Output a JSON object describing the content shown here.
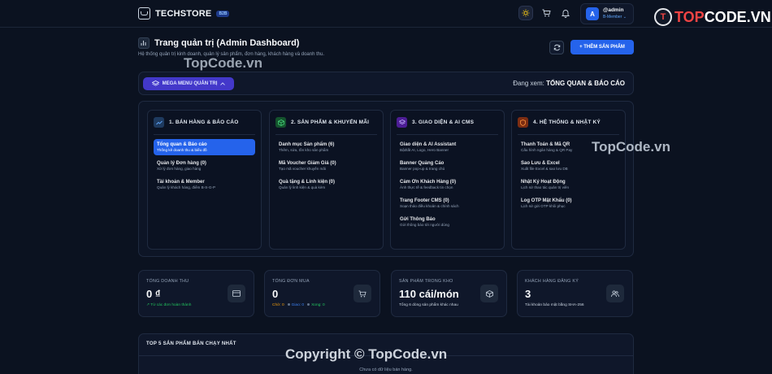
{
  "brand": {
    "name": "TECHSTORE",
    "badge": "B2B"
  },
  "topbar": {
    "icons": [
      "sun-icon",
      "cart-icon",
      "bell-icon"
    ],
    "user": {
      "avatar_letter": "A",
      "name": "@admin",
      "role": "B-Member ⌄"
    }
  },
  "watermark_logo": {
    "prefix": "T",
    "text_a": "TOP",
    "text_b": "CODE.VN"
  },
  "header": {
    "title": "Trang quản trị (Admin Dashboard)",
    "subtitle": "Hệ thống quản trị kinh doanh, quản lý sản phẩm, đơn hàng, khách hàng và doanh thu.",
    "add_button": "+ THÊM SẢN PHẨM"
  },
  "mega_bar": {
    "button": "MEGA MENU QUẢN TRỊ",
    "viewing_label": "Đang xem:",
    "viewing_value": "TỔNG QUAN & BÁO CÁO"
  },
  "mega_columns": [
    {
      "title": "1. BÁN HÀNG & BÁO CÁO",
      "items": [
        {
          "t": "Tổng quan & Báo cáo",
          "d": "Thống kê doanh thu & biểu đồ",
          "active": true
        },
        {
          "t": "Quản lý Đơn hàng (0)",
          "d": "Xử lý đơn hàng, giao hàng"
        },
        {
          "t": "Tài khoản & Member",
          "d": "Quản lý khách hàng, điểm B-S-G-P"
        }
      ]
    },
    {
      "title": "2. SẢN PHẨM & KHUYẾN MÃI",
      "items": [
        {
          "t": "Danh mục Sản phẩm (6)",
          "d": "Thêm, sửa, tồn kho sản phẩm"
        },
        {
          "t": "Mã Voucher Giảm Giá (0)",
          "d": "Tạo mã voucher khuyến mãi"
        },
        {
          "t": "Quà tặng & Linh kiện (0)",
          "d": "Quản lý linh kiện & quà kèm"
        }
      ]
    },
    {
      "title": "3. GIAO DIỆN & AI CMS",
      "items": [
        {
          "t": "Giao diện & AI Assistant",
          "d": "Bật/tắt AI, Logo, Hero Banner"
        },
        {
          "t": "Banner Quảng Cáo",
          "d": "Banner pop-up & trang chủ"
        },
        {
          "t": "Cảm Ơn Khách Hàng (0)",
          "d": "Ảnh thực tế & feedback tin chọn"
        },
        {
          "t": "Trang Footer CMS (0)",
          "d": "Soạn thảo điều khoản & chính sách"
        },
        {
          "t": "Gửi Thông Báo",
          "d": "Gửi thông báo tới người dùng"
        }
      ]
    },
    {
      "title": "4. HỆ THỐNG & NHẬT KÝ",
      "items": [
        {
          "t": "Thanh Toán & Mã QR",
          "d": "Cấu hình ngân hàng & QR Pay"
        },
        {
          "t": "Sao Lưu & Excel",
          "d": "Xuất file Excel & sao lưu DB"
        },
        {
          "t": "Nhật Ký Hoạt Động",
          "d": "Lịch sử thao tác quản trị viên"
        },
        {
          "t": "Log OTP Mật Khẩu (0)",
          "d": "Lịch sử gửi OTP khôi phục"
        }
      ]
    }
  ],
  "stats": [
    {
      "label": "TỔNG DOANH THU",
      "value": "0 ₫",
      "note": "↗ Từ các đơn hoàn thành"
    },
    {
      "label": "TỔNG ĐƠN MUA",
      "value": "0",
      "note_parts": [
        "Chờ: 0",
        "Giao: 0",
        "Xong: 0"
      ]
    },
    {
      "label": "SẢN PHẨM TRONG KHO",
      "value": "110 cái/món",
      "note": "Tổng 6 dòng sản phẩm khác nhau"
    },
    {
      "label": "KHÁCH HÀNG ĐĂNG KÝ",
      "value": "3",
      "note": "Tài khoản bảo mật bằng SHA-256"
    }
  ],
  "top_products": {
    "title": "TOP 5 SẢN PHẨM BÁN CHẠY NHẤT",
    "empty": "Chưa có dữ liệu bán hàng."
  },
  "watermarks": [
    "TopCode.vn",
    "TopCode.vn",
    "Copyright © TopCode.vn"
  ],
  "colors": {
    "accent": "#2563eb",
    "mega": "#4338ca",
    "bg": "#0b1220"
  }
}
